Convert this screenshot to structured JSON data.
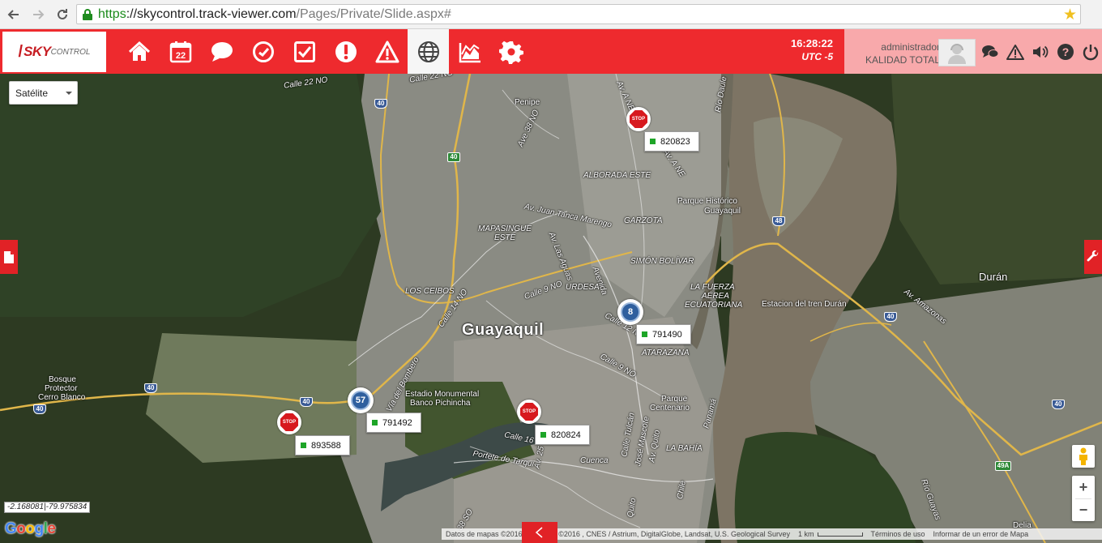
{
  "browser": {
    "url_scheme": "https",
    "url_host": "skycontrol.track-viewer.com",
    "url_path": "/Pages/Private/Slide.aspx#"
  },
  "header": {
    "logo_text": "SKY",
    "logo_sub": "CONTROL",
    "time": "16:28:22",
    "timezone": "UTC -5",
    "user_name": "administrador",
    "company": "KALIDAD TOTAL",
    "accent_color": "#ee2a2e",
    "toolbar_icons": [
      "home-icon",
      "calendar-icon",
      "chat-icon",
      "clock-check-icon",
      "checkbox-icon",
      "exclamation-icon",
      "warning-icon",
      "globe-icon",
      "area-chart-icon",
      "gear-icon"
    ],
    "calendar_day": "22"
  },
  "map": {
    "map_type": "Satélite",
    "coordinates": "-2.168081|-79.975834",
    "google": "Google",
    "attribution": "Datos de mapas ©2016 Imágenes ©2016 , CNES / Astrium, DigitalGlobe, Landsat, U.S. Geological Survey",
    "scale": "1 km",
    "terms": "Términos de uso",
    "report": "Informar de un error de Mapa",
    "labels": {
      "guayaquil": "Guayaquil",
      "duran": "Durán",
      "calle22": "Calle 22 NO",
      "calle22b": "Calle 22 NO",
      "penipe": "Penipe",
      "ave38": "Ave 38 NO",
      "alborada": "ALBORADA ESTE",
      "parque_hist": "Parque Histórico",
      "parque_hist2": "Guayaquil",
      "juan_tanca": "Av. Juan Tanca Marengo",
      "garzota": "GARZOTA",
      "mapasingue": "MAPASINGUE",
      "mapasingue2": "ESTE",
      "las_aguas": "Av. Las Aguas",
      "simon_bolivar": "SIMÓN BOLÍVAR",
      "fuerza_aerea": "LA FUERZA",
      "fuerza_aerea2": "AÉREA",
      "fuerza_aerea3": "ECUATORIANA",
      "tren": "Estacion del tren Durán",
      "amazonas": "Av. Amazonas",
      "urdesa": "URDESA",
      "calle9": "Calle 9 NO",
      "los_ceibos": "LOS CEIBOS",
      "calle14": "Calle 14 NO",
      "calle12": "Calle 12 N",
      "atarazana": "ATARAZANA",
      "calle9b": "Calle 9 NO",
      "bosque": "Bosque",
      "bosque2": "Protector",
      "bosque3": "Cerro Blanco",
      "estadio": "Estadio Monumental",
      "estadio2": "Banco Pichincha",
      "parque_cent": "Parque",
      "parque_cent2": "Centenario",
      "calle16": "Calle 16",
      "portete": "Portete de Tarqui",
      "cuenca": "Cuenca",
      "la_bahia": "LA BAHÍA",
      "bombero": "Vía del Bombero",
      "delia": "Delia",
      "rio_guayas": "Río Guayas",
      "avenida": "Avenida",
      "ave_ne": "Av. A NE",
      "ave_ne2": "Av. A NE",
      "panama": "Panamá",
      "chile": "Chile",
      "quito": "Quito",
      "tulcan": "Calle Tulcán",
      "mascote": "José Mascote",
      "av_quito": "Av. Quito",
      "rio_daule": "Río Daule",
      "calle38": "38 SO",
      "av_2": "Av. 25"
    },
    "shields": [
      "40",
      "40",
      "48",
      "40",
      "40",
      "40",
      "40",
      "40",
      "40",
      "40",
      "49A"
    ],
    "markers": [
      {
        "type": "stop",
        "text": "STOP",
        "label": "820823"
      },
      {
        "type": "cluster",
        "text": "8",
        "label": "791490"
      },
      {
        "type": "cluster",
        "text": "57",
        "label": "791492"
      },
      {
        "type": "stop",
        "text": "STOP",
        "label": "893588"
      },
      {
        "type": "stop",
        "text": "STOP",
        "label": "820824"
      }
    ]
  }
}
